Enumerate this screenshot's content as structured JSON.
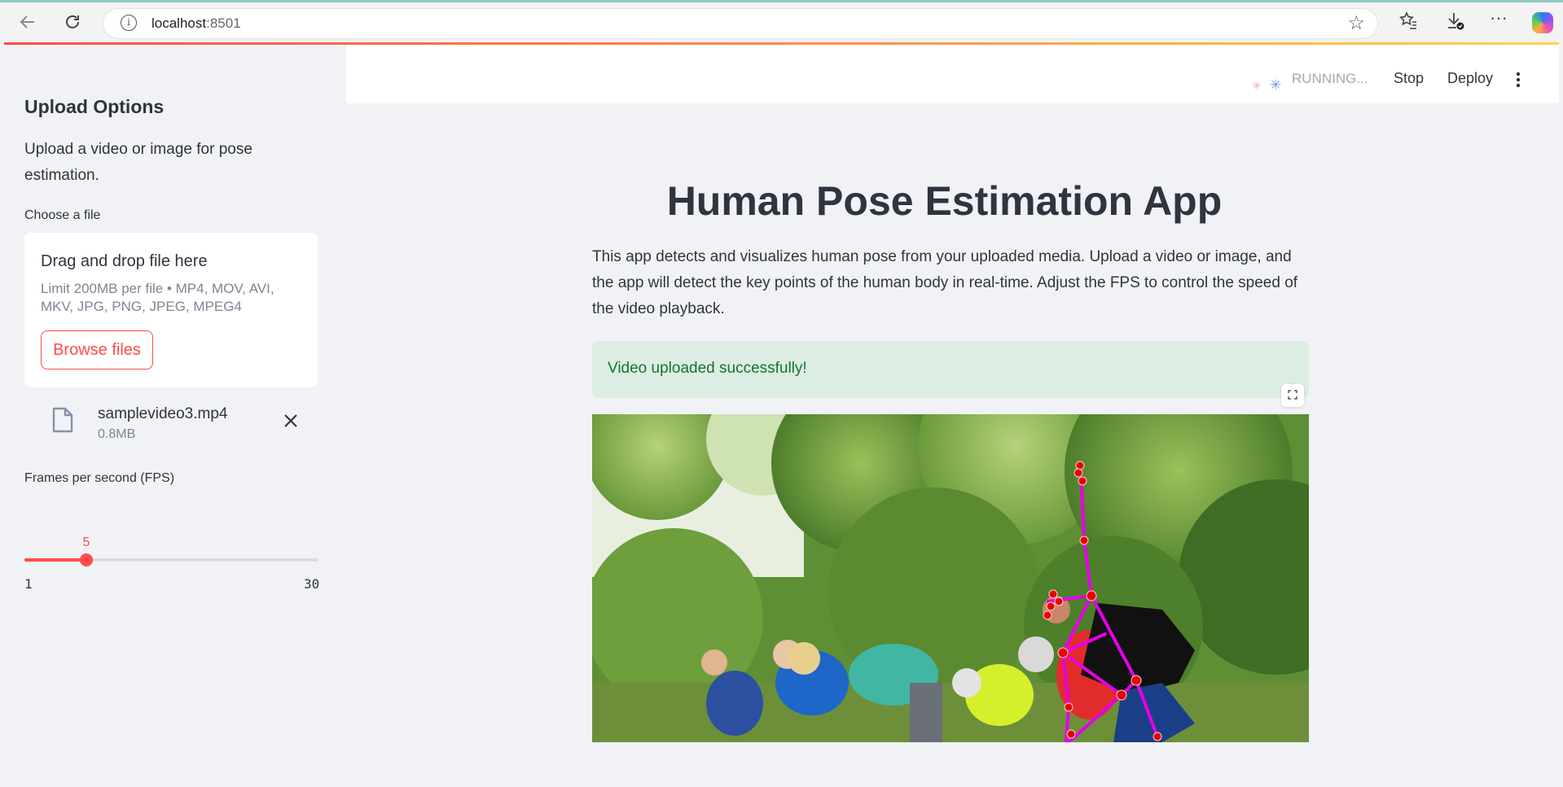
{
  "browser": {
    "url_host": "localhost",
    "url_port": ":8501",
    "icons": {
      "back": "back-arrow-icon",
      "refresh": "refresh-icon",
      "info": "info-icon",
      "star": "star-icon",
      "favorites": "favorites-icon",
      "downloads": "downloads-icon",
      "more": "more-icon",
      "copilot": "copilot-icon"
    }
  },
  "header": {
    "status": "RUNNING...",
    "stop_label": "Stop",
    "deploy_label": "Deploy"
  },
  "sidebar": {
    "title": "Upload Options",
    "description": "Upload a video or image for pose estimation.",
    "uploader": {
      "label": "Choose a file",
      "drop_title": "Drag and drop file here",
      "limit_text": "Limit 200MB per file • MP4, MOV, AVI, MKV, JPG, PNG, JPEG, MPEG4",
      "browse_label": "Browse files"
    },
    "file": {
      "name": "samplevideo3.mp4",
      "size": "0.8MB"
    },
    "fps": {
      "label": "Frames per second (FPS)",
      "value": 5,
      "min": 1,
      "max": 30,
      "min_label": "1",
      "max_label": "30",
      "value_label": "5"
    }
  },
  "main": {
    "title": "Human Pose Estimation App",
    "intro": "This app detects and visualizes human pose from your uploaded media. Upload a video or image, and the app will detect the key points of the human body in real-time. Adjust the FPS to control the speed of the video playback.",
    "success_message": "Video uploaded successfully!"
  },
  "colors": {
    "accent": "#ff4b4b",
    "success_bg": "#dcede3",
    "success_text": "#177233",
    "skeleton": "#e600e6",
    "keypoint": "#e80000"
  }
}
